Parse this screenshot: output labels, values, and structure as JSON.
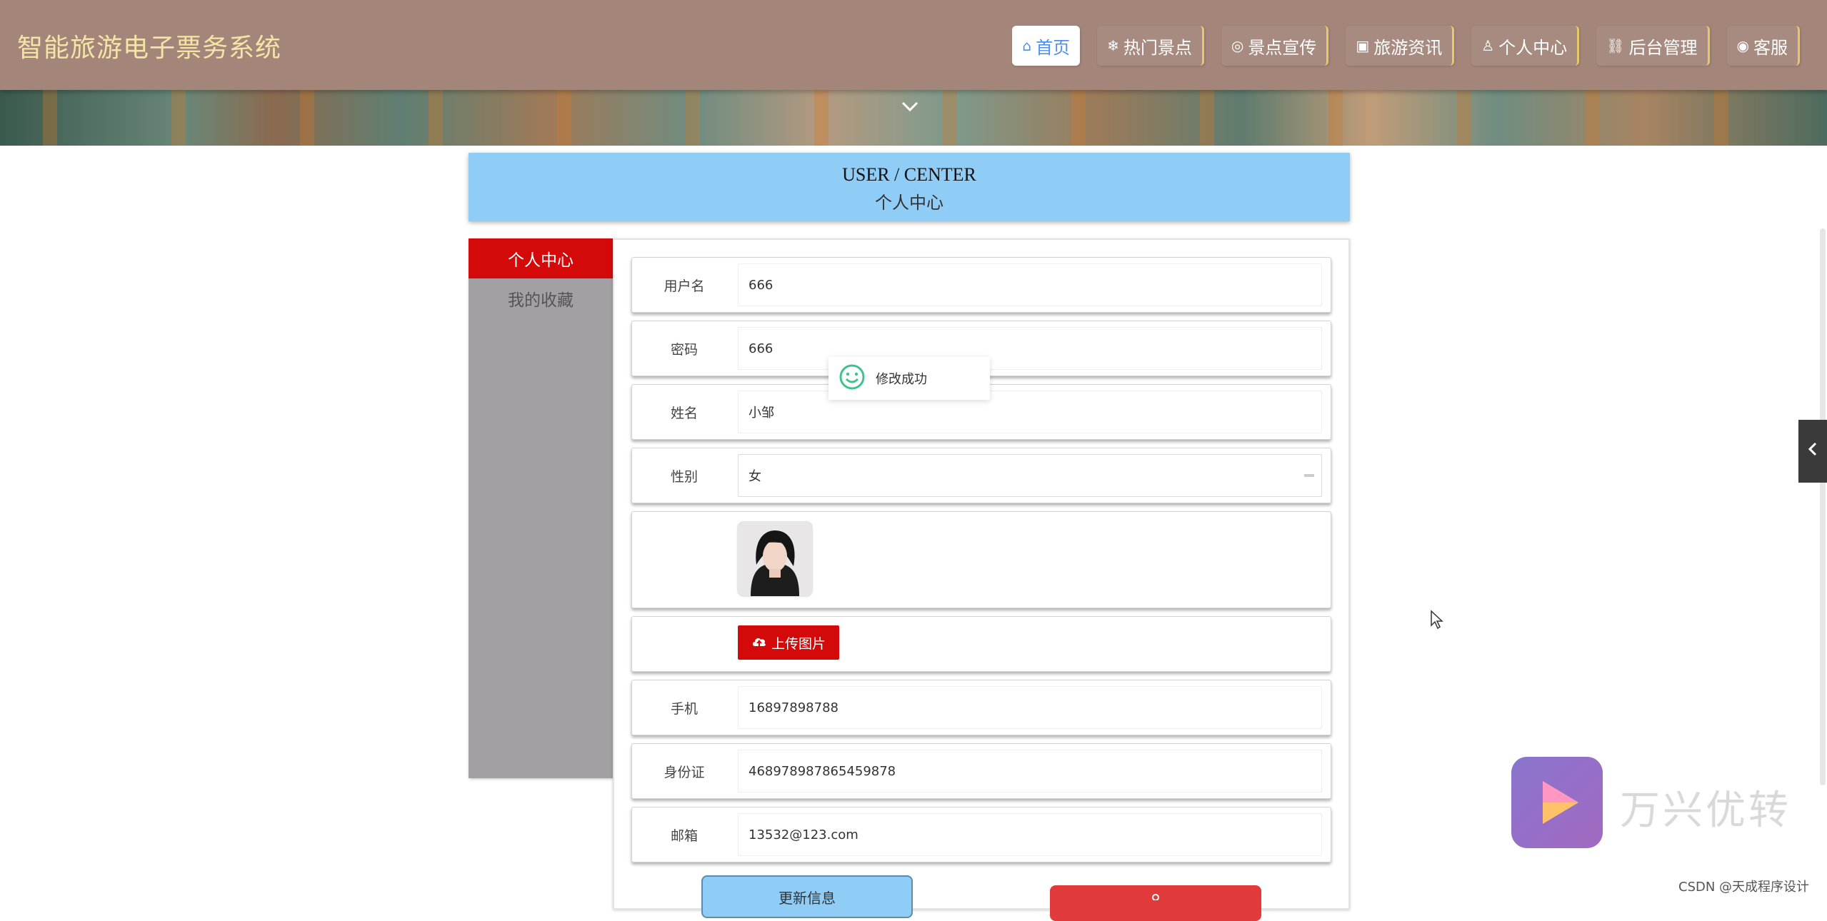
{
  "header": {
    "site_title": "智能旅游电子票务系统",
    "nav": [
      {
        "icon": "home-icon",
        "glyph": "⌂",
        "label": "首页",
        "active": true
      },
      {
        "icon": "snowflake-icon",
        "glyph": "❄",
        "label": "热门景点",
        "active": false
      },
      {
        "icon": "palette-icon",
        "glyph": "◎",
        "label": "景点宣传",
        "active": false
      },
      {
        "icon": "gift-icon",
        "glyph": "▣",
        "label": "旅游资讯",
        "active": false
      },
      {
        "icon": "user-icon",
        "glyph": "♙",
        "label": "个人中心",
        "active": false
      },
      {
        "icon": "link-icon",
        "glyph": "⛓",
        "label": "后台管理",
        "active": false
      },
      {
        "icon": "support-icon",
        "glyph": "◉",
        "label": "客服",
        "active": false
      }
    ]
  },
  "title": {
    "en": "USER / CENTER",
    "cn": "个人中心"
  },
  "sidebar": {
    "items": [
      {
        "label": "个人中心",
        "active": true
      },
      {
        "label": "我的收藏",
        "active": false
      }
    ]
  },
  "form": {
    "username": {
      "label": "用户名",
      "value": "666"
    },
    "password": {
      "label": "密码",
      "value": "666"
    },
    "name": {
      "label": "姓名",
      "value": "小邹"
    },
    "gender": {
      "label": "性别",
      "value": "女"
    },
    "upload_label": "上传图片",
    "phone": {
      "label": "手机",
      "value": "16897898788"
    },
    "id_card": {
      "label": "身份证",
      "value": "468978987865459878"
    },
    "email": {
      "label": "邮箱",
      "value": "13532@123.com"
    }
  },
  "buttons": {
    "update": "更新信息"
  },
  "toast": {
    "text": "修改成功"
  },
  "watermark": {
    "brand": "万兴优转",
    "csdn": "CSDN @天成程序设计"
  },
  "colors": {
    "header_bg": "#a3857a",
    "title_band": "#8fcdf7",
    "accent_red": "#d40a0a",
    "title_gold": "#f4e4a6"
  }
}
